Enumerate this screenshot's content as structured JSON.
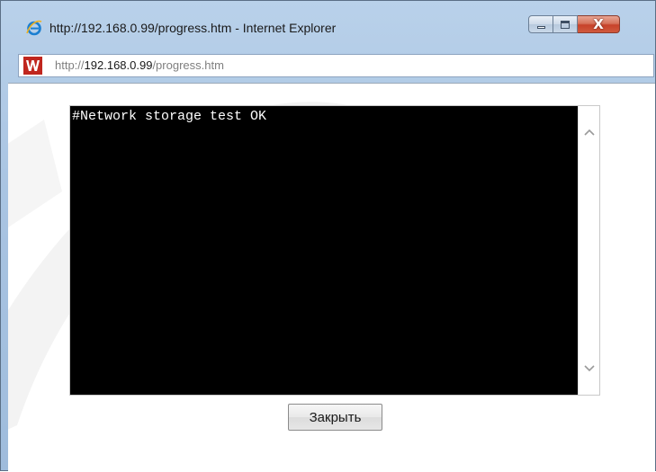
{
  "window": {
    "title": "http://192.168.0.99/progress.htm - Internet Explorer",
    "controls": {
      "minimize_icon": "minimize-icon",
      "maximize_icon": "maximize-icon",
      "close_glyph": "X"
    }
  },
  "address_bar": {
    "url_prefix": "http://",
    "url_host": "192.168.0.99",
    "url_path": "/progress.htm",
    "site_icon": "site-logo-icon"
  },
  "terminal": {
    "output": "#Network storage test OK"
  },
  "actions": {
    "close_label": "Закрыть"
  },
  "colors": {
    "terminal_background": "#000000",
    "terminal_text": "#ffffff",
    "title_bar": "#b9d1ea",
    "close_button": "#c7422a",
    "watermark": "#f2f2f2"
  }
}
